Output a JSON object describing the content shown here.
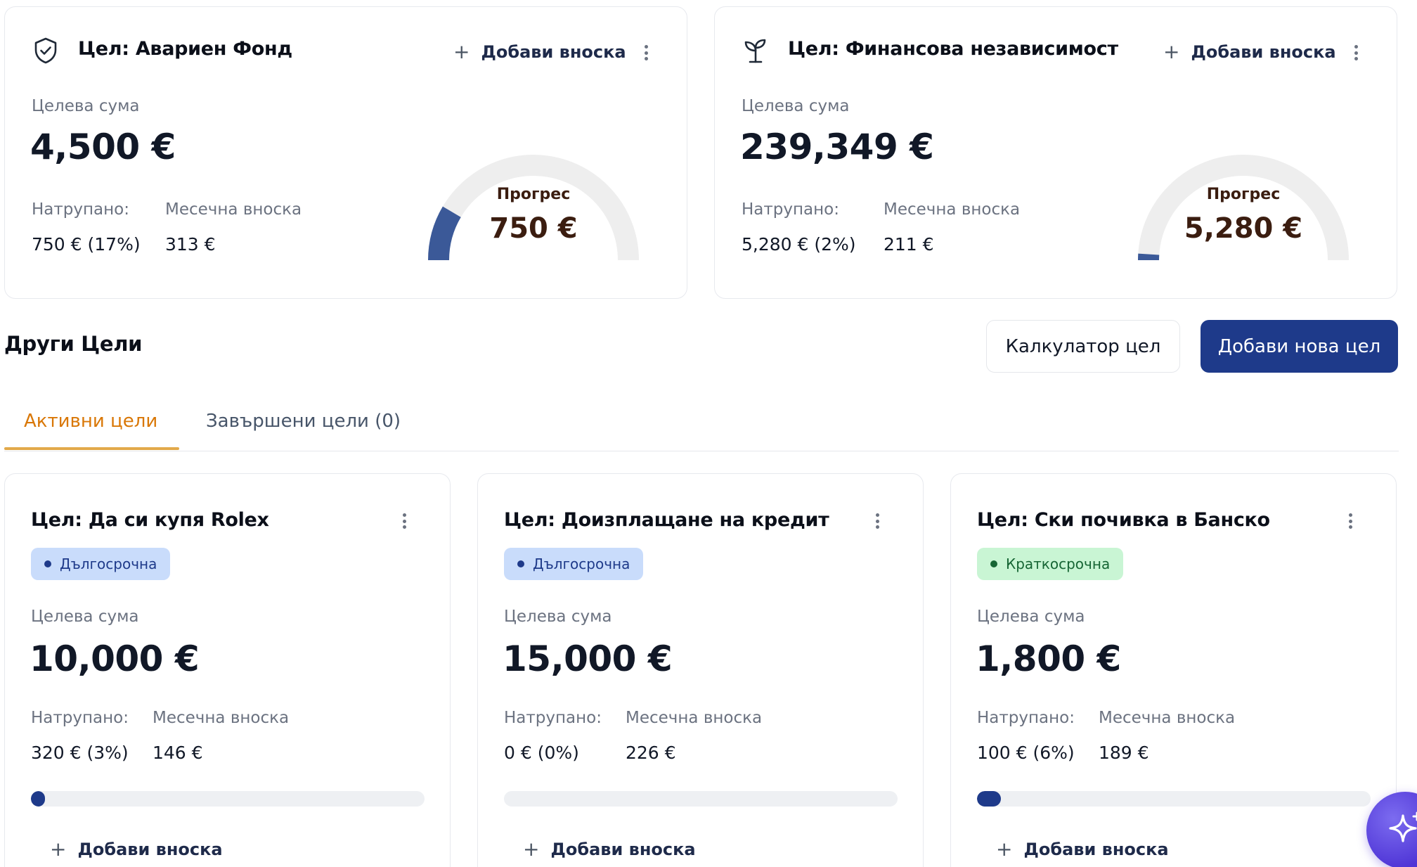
{
  "top_goals": [
    {
      "title": "Цел: Авариен Фонд",
      "icon": "shield-check-icon",
      "add_label": "Добави вноска",
      "target_label": "Целева сума",
      "target_value": "4,500 €",
      "saved_label": "Натрупано:",
      "saved_value": "750 € (17%)",
      "monthly_label": "Месечна вноска",
      "monthly_value": "313 €",
      "progress_label": "Прогрес",
      "progress_value": "750 €",
      "progress_fraction": 0.17
    },
    {
      "title": "Цел: Финансова независимост",
      "icon": "sprout-icon",
      "add_label": "Добави вноска",
      "target_label": "Целева сума",
      "target_value": "239,349 €",
      "saved_label": "Натрупано:",
      "saved_value": "5,280 € (2%)",
      "monthly_label": "Месечна вноска",
      "monthly_value": "211 €",
      "progress_label": "Прогрес",
      "progress_value": "5,280 €",
      "progress_fraction": 0.02
    }
  ],
  "section": {
    "title": "Други Цели",
    "calculator_label": "Калкулатор цел",
    "add_goal_label": "Добави нова цел"
  },
  "tabs": {
    "active_label": "Активни цели",
    "completed_label": "Завършени цели (0)"
  },
  "goals": [
    {
      "title": "Цел: Да си купя Rolex",
      "badge": "Дългосрочна",
      "badge_type": "long",
      "target_label": "Целева сума",
      "target_value": "10,000 €",
      "saved_label": "Натрупано:",
      "saved_value": "320 € (3%)",
      "monthly_label": "Месечна вноска",
      "monthly_value": "146 €",
      "progress_fraction": 0.03,
      "add_label": "Добави вноска"
    },
    {
      "title": "Цел: Доизплащане на кредит",
      "badge": "Дългосрочна",
      "badge_type": "long",
      "target_label": "Целева сума",
      "target_value": "15,000 €",
      "saved_label": "Натрупано:",
      "saved_value": "0 € (0%)",
      "monthly_label": "Месечна вноска",
      "monthly_value": "226 €",
      "progress_fraction": 0.0,
      "add_label": "Добави вноска"
    },
    {
      "title": "Цел: Ски почивка в Банско",
      "badge": "Краткосрочна",
      "badge_type": "short",
      "target_label": "Целева сума",
      "target_value": "1,800 €",
      "saved_label": "Натрупано:",
      "saved_value": "100 € (6%)",
      "monthly_label": "Месечна вноска",
      "monthly_value": "189 €",
      "progress_fraction": 0.06,
      "add_label": "Добави вноска"
    }
  ],
  "colors": {
    "primary": "#1e3a8a",
    "gauge_fill": "#3b5998",
    "gauge_track": "#eeeeee",
    "tab_active": "#d97706",
    "badge_long_bg": "#c9dcfb",
    "badge_short_bg": "#c9f5d4",
    "fab": "#5b3fe0"
  },
  "fab": {
    "icon": "sparkles-icon"
  }
}
